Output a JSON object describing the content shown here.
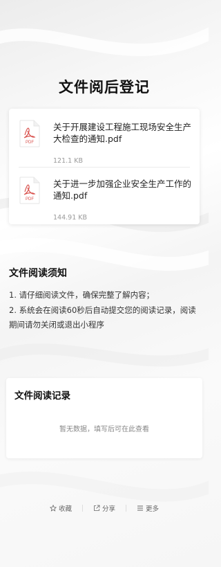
{
  "page": {
    "title": "文件阅后登记"
  },
  "files": [
    {
      "icon": "pdf-icon",
      "icon_label": "PDF",
      "name": "关于开展建设工程施工现场安全生产大检查的通知.pdf",
      "size": "121.1 KB"
    },
    {
      "icon": "pdf-icon",
      "icon_label": "PDF",
      "name": "关于进一步加强企业安全生产工作的通知.pdf",
      "size": "144.91 KB"
    }
  ],
  "notice": {
    "title": "文件阅读须知",
    "items": [
      "1. 请仔细阅读文件，确保完整了解内容；",
      "2. 系统会在阅读60秒后自动提交您的阅读记录，阅读期间请勿关闭或退出小程序"
    ]
  },
  "records": {
    "title": "文件阅读记录",
    "empty_text": "暂无数据，填写后可在此查看"
  },
  "footer": {
    "favorite_label": "收藏",
    "share_label": "分享",
    "more_label": "更多"
  },
  "colors": {
    "pdf_red": "#d9534f",
    "text_primary": "#111111",
    "text_muted": "#999999"
  }
}
